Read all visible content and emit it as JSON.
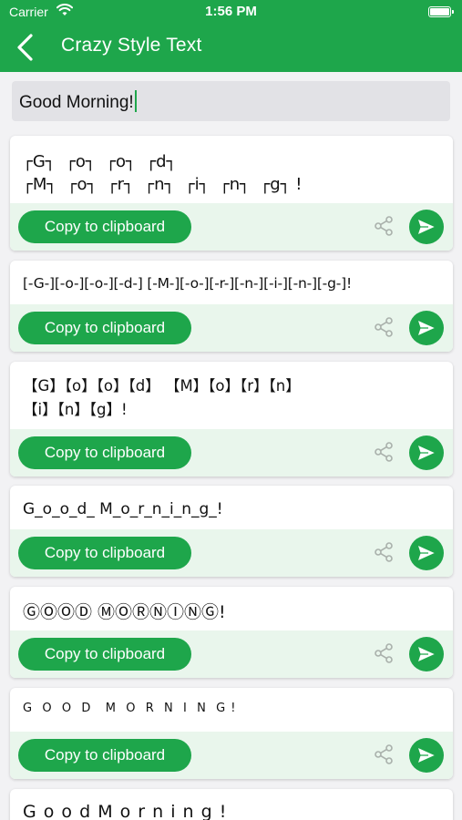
{
  "status_bar": {
    "carrier": "Carrier",
    "time": "1:56 PM"
  },
  "header": {
    "title": "Crazy Style Text"
  },
  "input": {
    "value": "Good Morning!"
  },
  "card_actions": {
    "copy_label": "Copy to clipboard",
    "share_icon": "share-icon",
    "send_icon": "send-icon"
  },
  "colors": {
    "accent": "#1ea64b",
    "action_bar": "#e9f6ec",
    "input_bg": "#e2e2e6"
  },
  "styles": [
    {
      "text": "┌G┐  ┌o┐  ┌o┐  ┌d┐\n┌M┐  ┌o┐  ┌r┐  ┌n┐  ┌i┐  ┌n┐  ┌g┐ !"
    },
    {
      "text": "[-G-][-o-][-o-][-d-] [-M-][-o-][-r-][-n-][-i-][-n-][-g-]!"
    },
    {
      "text": "【G】【o】【o】【d】 【M】【o】【r】【n】\n【i】【n】【g】!"
    },
    {
      "text": "G_o_o_d_ M_o_r_n_i_n_g_!"
    },
    {
      "text": "ⒼⓄⓄⒹ ⓂⓄⓇⓃⒾⓃⒼ!"
    },
    {
      "text": "G  O  O  D   M  O  R  N  I  N  G !"
    },
    {
      "text": "G o o d M o r n i n g !"
    }
  ]
}
